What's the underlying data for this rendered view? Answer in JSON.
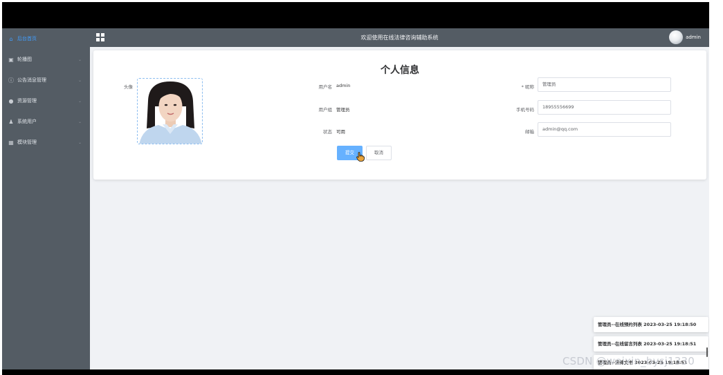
{
  "sidebar": {
    "items": [
      {
        "label": "后台首页",
        "icon": "home-icon"
      },
      {
        "label": "轮播图",
        "icon": "image-icon"
      },
      {
        "label": "公告消息管理",
        "icon": "info-circle-icon"
      },
      {
        "label": "资源管理",
        "icon": "location-icon"
      },
      {
        "label": "系统用户",
        "icon": "user-icon"
      },
      {
        "label": "模块管理",
        "icon": "grid-icon"
      }
    ]
  },
  "header": {
    "title": "欢迎使用在线法律咨询辅助系统",
    "username": "admin"
  },
  "profile": {
    "title": "个人信息",
    "avatar_label": "头像",
    "username_label": "用户名",
    "username_value": "admin",
    "group_label": "用户组",
    "group_value": "管理员",
    "status_label": "状态",
    "status_value": "可用",
    "nickname_label": "* 昵称",
    "nickname_value": "管理员",
    "phone_label": "手机号码",
    "phone_value": "18955556699",
    "email_label": "邮箱",
    "email_value": "admin@qq.com",
    "submit_label": "提交",
    "cancel_label": "取消"
  },
  "notifications": [
    {
      "text": "管理员--在线预约列表 2023-03-25 19:18:50"
    },
    {
      "text": "管理员--在线留言列表 2023-03-25 19:18:51"
    },
    {
      "text": "管理员--法律文书 2023-03-25 19:18:51"
    }
  ],
  "watermark": "CSDN @weixin_bysj1330",
  "colors": {
    "sidebar_bg": "#545c64",
    "accent": "#409eff",
    "submit_bg": "#66b1ff",
    "app_bg": "#f0f2f5"
  }
}
